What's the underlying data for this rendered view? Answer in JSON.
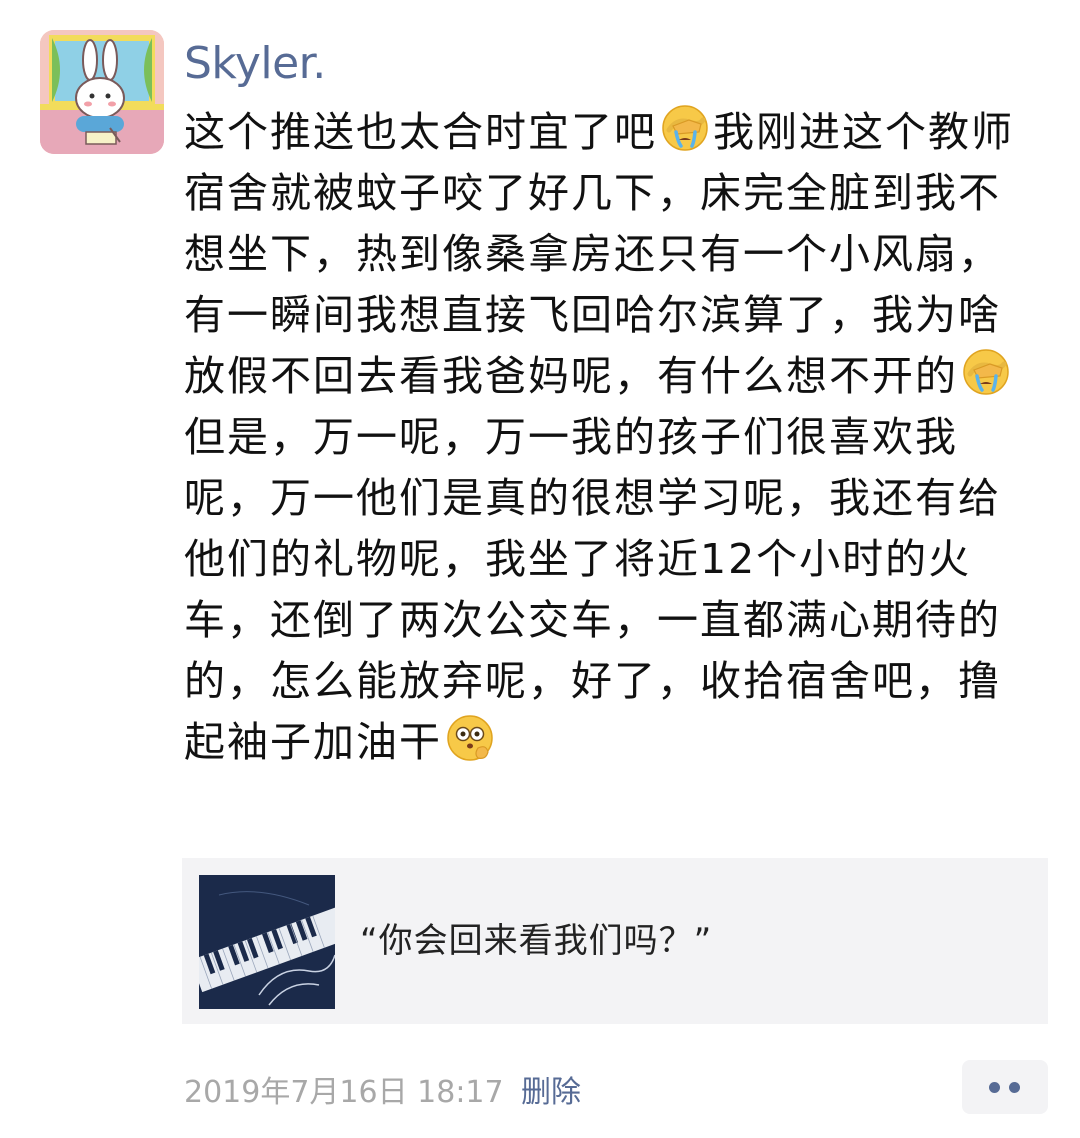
{
  "post": {
    "username": "Skyler.",
    "paragraphs": [
      {
        "segments": [
          {
            "text": "这个推送也太合时宜了吧"
          },
          {
            "emoji": "facepalm-crying-emoji"
          },
          {
            "text": "我刚进这个教师宿舍就被蚊子咬了好几下，床完全脏到我不想坐下，热到像桑拿房还只有一个小风扇，有一瞬间我想直接飞回哈尔滨算了，我为啥放假不回去看我爸妈呢，有什么想不开的"
          },
          {
            "emoji": "facepalm-crying-emoji"
          }
        ]
      },
      {
        "segments": [
          {
            "text": "但是，万一呢，万一我的孩子们很喜欢我呢，万一他们是真的很想学习呢，我还有给他们的礼物呢，我坐了将近12个小时的火车，还倒了两次公交车，一直都满心期待的的，怎么能放弃呢，好了，收拾宿舍吧，撸起袖子加油干"
          },
          {
            "emoji": "thinking-wide-eyes-emoji"
          }
        ]
      }
    ],
    "link_card": {
      "title": "“你会回来看我们吗？”",
      "thumbnail_icon": "piano-keys-thumbnail"
    },
    "footer": {
      "timestamp": "2019年7月16日 18:17",
      "delete_label": "删除",
      "more_icon": "more-dots-icon"
    }
  },
  "colors": {
    "username": "#576b95",
    "body_text": "#111111",
    "timestamp": "#a8a8a8",
    "card_background": "#f3f3f5"
  }
}
